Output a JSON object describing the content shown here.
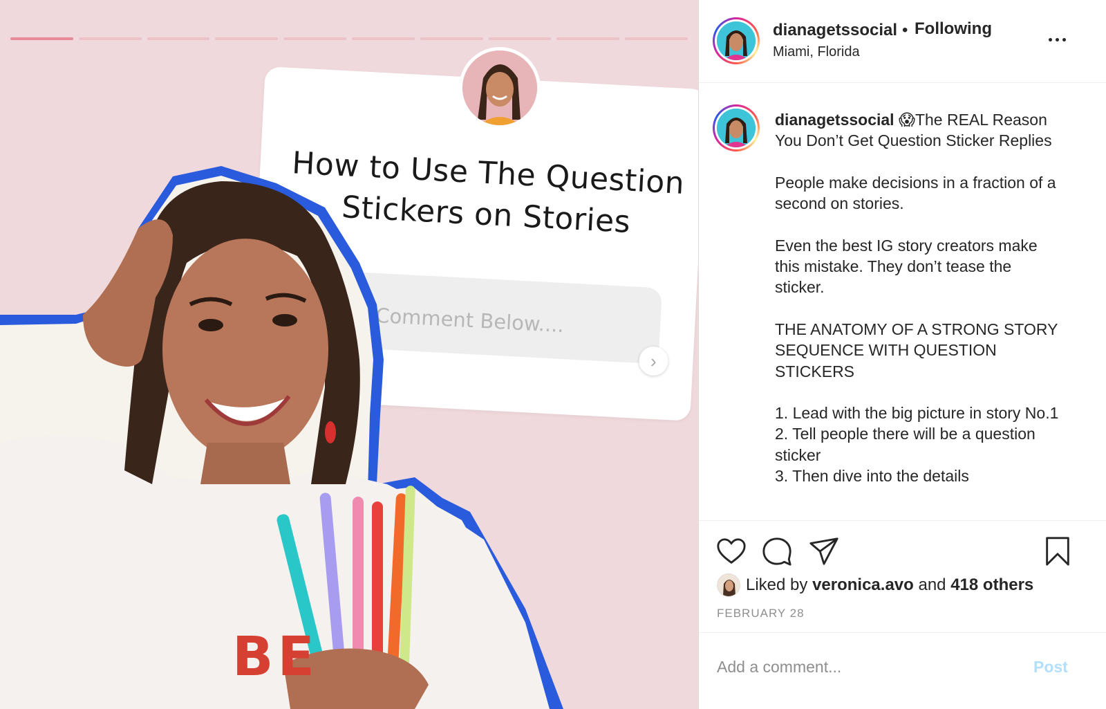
{
  "post": {
    "story_sticker": {
      "title_line1": "How to Use The Question",
      "title_line2": "Stickers on Stories",
      "input_placeholder": "Comment Below....",
      "send_icon": "chevron-right-icon",
      "shirt_letters": "BE"
    },
    "progress_segments": 10,
    "progress_active": 1
  },
  "header": {
    "username": "dianagetssocial",
    "separator": "•",
    "follow_status": "Following",
    "location": "Miami, Florida",
    "more_icon": "more-horizontal-icon"
  },
  "caption": {
    "username": "dianagetssocial",
    "emoji": "😱",
    "text": "The REAL Reason You Don’t Get Question Sticker Replies\n\nPeople make decisions in a fraction of a second on stories.\n\nEven the best IG story creators make this mistake. They don’t tease the sticker.\n\nTHE ANATOMY OF A STRONG STORY SEQUENCE WITH QUESTION STICKERS\n\n1. Lead with the big picture in story No.1\n2. Tell people there will be a question sticker\n3. Then dive into the details"
  },
  "actions": {
    "like_icon": "heart-icon",
    "comment_icon": "comment-bubble-icon",
    "share_icon": "paper-plane-icon",
    "save_icon": "bookmark-icon"
  },
  "likes": {
    "prefix": "Liked by",
    "user": "veronica.avo",
    "conjunction": "and",
    "others": "418 others"
  },
  "date": "FEBRUARY 28",
  "comment": {
    "placeholder": "Add a comment...",
    "post_label": "Post"
  },
  "colors": {
    "background_pink": "#f0d9dc",
    "outline_blue": "#2a5bdc",
    "post_disabled": "#b2dffc"
  }
}
